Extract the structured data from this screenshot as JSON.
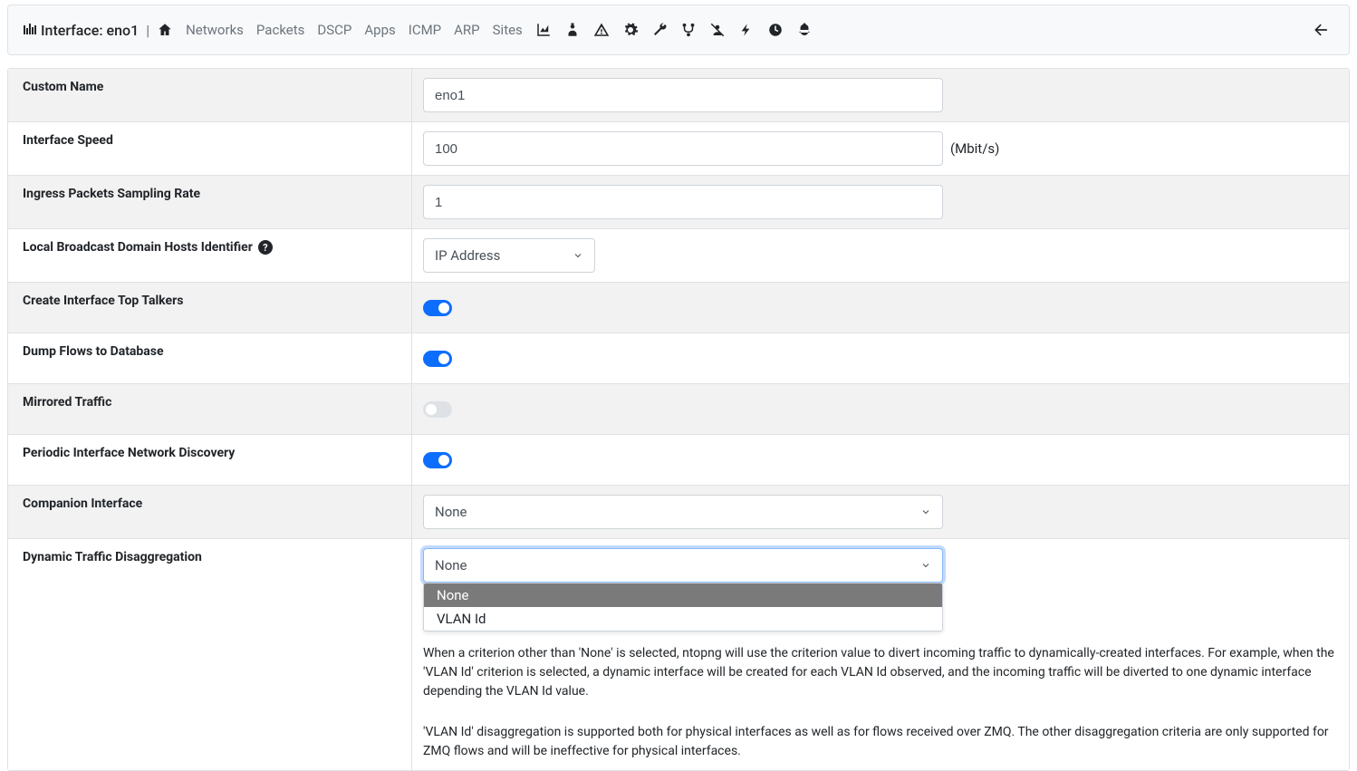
{
  "header": {
    "brand_prefix": "Interface:",
    "brand_name": "eno1",
    "links": [
      "Networks",
      "Packets",
      "DSCP",
      "Apps",
      "ICMP",
      "ARP",
      "Sites"
    ]
  },
  "rows": {
    "custom_name": {
      "label": "Custom Name",
      "value": "eno1"
    },
    "iface_speed": {
      "label": "Interface Speed",
      "value": "100",
      "unit": "(Mbit/s)"
    },
    "ingress_rate": {
      "label": "Ingress Packets Sampling Rate",
      "value": "1"
    },
    "lbdh": {
      "label": "Local Broadcast Domain Hosts Identifier",
      "select": "IP Address"
    },
    "top_talkers": {
      "label": "Create Interface Top Talkers",
      "on": true
    },
    "dump_flows": {
      "label": "Dump Flows to Database",
      "on": true
    },
    "mirrored": {
      "label": "Mirrored Traffic",
      "on": false
    },
    "periodic": {
      "label": "Periodic Interface Network Discovery",
      "on": true
    },
    "companion": {
      "label": "Companion Interface",
      "select": "None"
    },
    "dynamic": {
      "label": "Dynamic Traffic Disaggregation",
      "select": "None",
      "options": [
        "None",
        "VLAN Id"
      ],
      "desc1": "When a criterion other than 'None' is selected, ntopng will use the criterion value to divert incoming traffic to dynamically-created interfaces. For example, when the 'VLAN Id' criterion is selected, a dynamic interface will be created for each VLAN Id observed, and the incoming traffic will be diverted to one dynamic interface depending the VLAN Id value.",
      "desc2": "'VLAN Id' disaggregation is supported both for physical interfaces as well as for flows received over ZMQ. The other disaggregation criteria are only supported for ZMQ flows and will be ineffective for physical interfaces."
    }
  }
}
